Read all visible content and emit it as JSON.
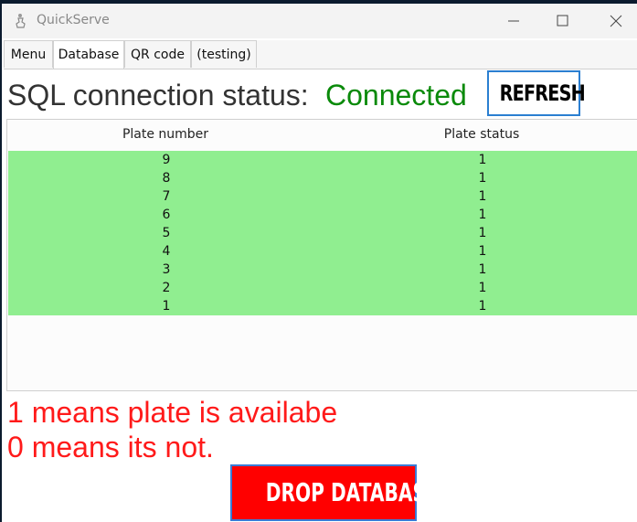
{
  "window": {
    "title": "QuickServe"
  },
  "tabs": [
    {
      "label": "Menu"
    },
    {
      "label": "Database"
    },
    {
      "label": "QR code"
    },
    {
      "label": "(testing)"
    }
  ],
  "active_tab": "Database",
  "status": {
    "label": "SQL connection status:",
    "value": "Connected",
    "value_color": "#0a8a0a"
  },
  "refresh_button": {
    "label": "REFRESH"
  },
  "table": {
    "columns": [
      "Plate number",
      "Plate status"
    ],
    "row_color": "#90ee90",
    "rows": [
      [
        "9",
        "1"
      ],
      [
        "8",
        "1"
      ],
      [
        "7",
        "1"
      ],
      [
        "6",
        "1"
      ],
      [
        "5",
        "1"
      ],
      [
        "4",
        "1"
      ],
      [
        "3",
        "1"
      ],
      [
        "2",
        "1"
      ],
      [
        "1",
        "1"
      ]
    ]
  },
  "legend": {
    "line1": "1 means plate is availabe",
    "line2": "0 means its not.",
    "color": "#ff1a1a"
  },
  "drop_button": {
    "label": "DROP DATABASE",
    "color": "#ff0000"
  }
}
